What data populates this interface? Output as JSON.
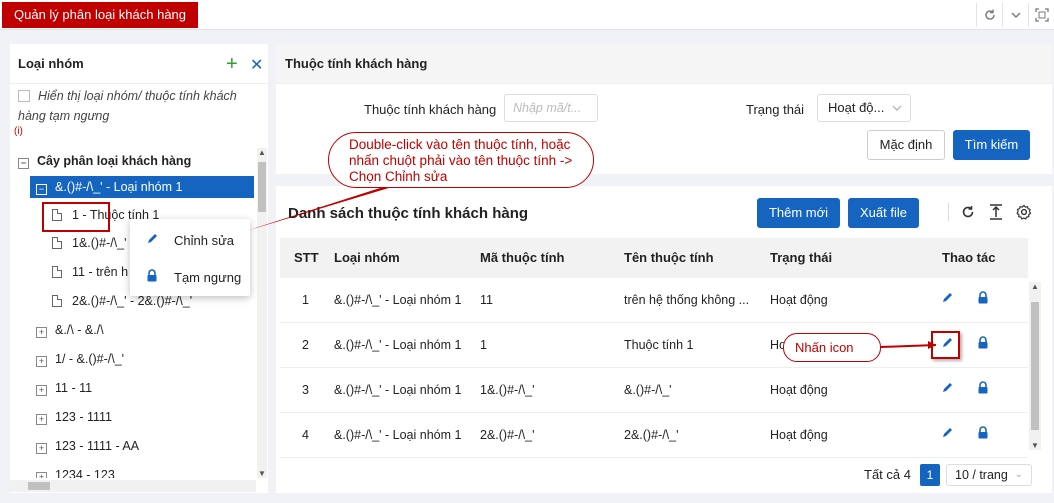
{
  "top": {
    "tab_label": "Quản lý phân loại khách hàng",
    "icons": [
      "refresh-icon",
      "chevron-down-icon",
      "fullscreen-icon"
    ]
  },
  "left": {
    "title": "Loại nhóm",
    "show_inactive_label": "Hiển thị loại nhóm/ thuộc tính khách hàng tạm ngưng",
    "info_mark": "(i)",
    "tree_root": "Cây phân loại khách hàng",
    "tree": [
      {
        "label": "&.()#-/\\_' - Loại nhóm 1",
        "expanded": true,
        "selected": true
      },
      {
        "label": "1 - Thuộc tính 1",
        "leaf": true
      },
      {
        "label": "1&.()#-/\\_'",
        "leaf": true
      },
      {
        "label": "11 - trên h",
        "leaf": true
      },
      {
        "label": "2&.()#-/\\_' - 2&.()#-/\\_'",
        "leaf": true
      },
      {
        "label": "&./\\ - &./\\"
      },
      {
        "label": "1/ - &.()#-/\\_'"
      },
      {
        "label": "11 - 11"
      },
      {
        "label": "123 - 1111"
      },
      {
        "label": "123 - 1111 - AA"
      },
      {
        "label": "1234 - 123"
      }
    ]
  },
  "context_menu": {
    "edit_label": "Chỉnh sửa",
    "suspend_label": "Tạm ngưng"
  },
  "filter": {
    "title": "Thuộc tính khách hàng",
    "attr_label": "Thuộc tính khách hàng",
    "attr_placeholder": "Nhập mã/t...",
    "status_label": "Trạng thái",
    "status_value": "Hoạt độ...",
    "default_btn": "Mặc định",
    "search_btn": "Tìm kiếm"
  },
  "list": {
    "title": "Danh sách thuộc tính khách hàng",
    "add_btn": "Thêm mới",
    "export_btn": "Xuất file",
    "columns": [
      "STT",
      "Loại nhóm",
      "Mã thuộc tính",
      "Tên thuộc tính",
      "Trạng thái",
      "Thao tác"
    ],
    "rows": [
      {
        "stt": "1",
        "group": "&.()#-/\\_' - Loại nhóm 1",
        "code": "11",
        "name": "trên hệ thống không ...",
        "status": "Hoạt động"
      },
      {
        "stt": "2",
        "group": "&.()#-/\\_' - Loại nhóm 1",
        "code": "1",
        "name": "Thuộc tính 1",
        "status": "Hoạt động"
      },
      {
        "stt": "3",
        "group": "&.()#-/\\_' - Loại nhóm 1",
        "code": "1&.()#-/\\_'",
        "name": "&.()#-/\\_'",
        "status": "Hoạt động"
      },
      {
        "stt": "4",
        "group": "&.()#-/\\_' - Loại nhóm 1",
        "code": "2&.()#-/\\_'",
        "name": "2&.()#-/\\_'",
        "status": "Hoạt động"
      }
    ],
    "total": "Tất cả 4",
    "page": "1",
    "page_size": "10 / trang"
  },
  "annotations": {
    "bubble1": "Double-click vào tên thuộc tính, hoặc nhấn chuột phải vào tên thuộc tính -> Chọn Chỉnh sửa",
    "bubble2": "Nhấn icon",
    "color": "#c00000"
  }
}
